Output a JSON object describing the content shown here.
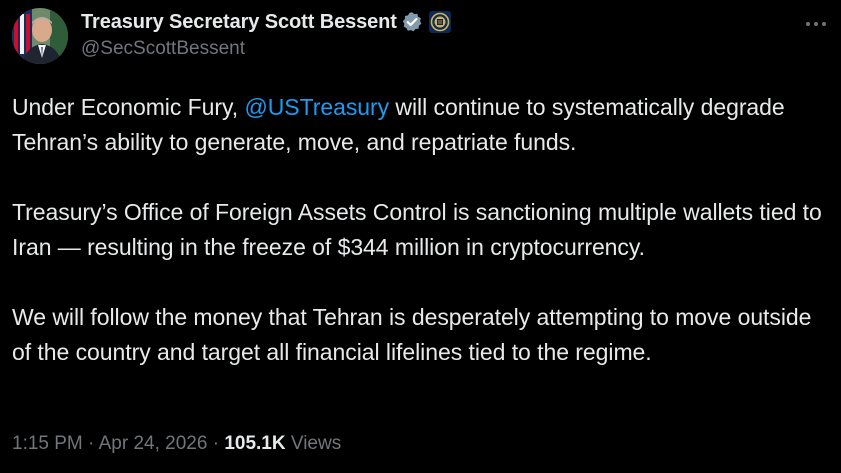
{
  "author": {
    "display_name": "Treasury Secretary Scott Bessent",
    "handle": "@SecScottBessent",
    "verified_badge_color": "#829aab",
    "avatar_icon": "portrait-avatar",
    "affiliation_icon": "treasury-seal-icon"
  },
  "tweet": {
    "para1": {
      "before": "Under Economic Fury, ",
      "mention": "@USTreasury",
      "after": " will continue to systematically degrade Tehran’s ability to generate, move, and repatriate funds."
    },
    "para2": "Treasury’s Office of Foreign Assets Control is sanctioning multiple wallets tied to Iran — resulting in the freeze of $344 million in cryptocurrency.",
    "para3": "We will follow the money that Tehran is desperately attempting to move outside of the country and target all financial lifelines tied to the regime."
  },
  "meta": {
    "time": "1:15 PM",
    "separator": "·",
    "date": "Apr 24, 2026",
    "views_count": "105.1K",
    "views_label": "Views"
  },
  "colors": {
    "background": "#000000",
    "text": "#e7e9ea",
    "secondary": "#71767b",
    "link": "#1d9bf0"
  }
}
